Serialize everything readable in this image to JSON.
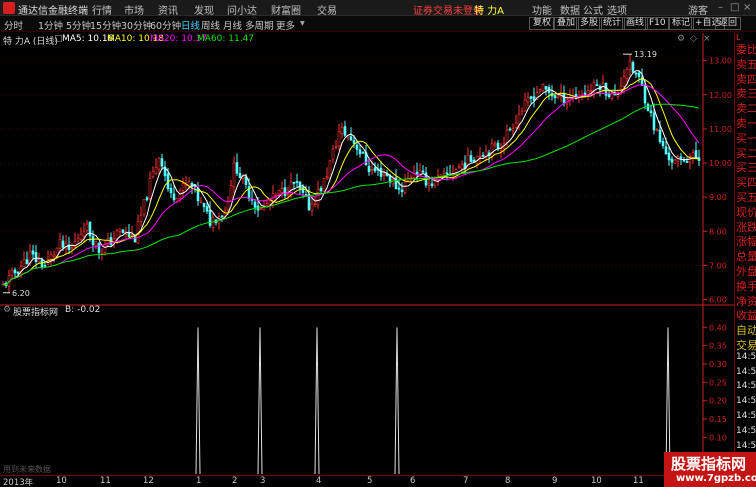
{
  "titlebar": {
    "app_name": "通达信金融终端",
    "menus": [
      "行情",
      "市场",
      "资讯",
      "发现",
      "问小达",
      "财富圈",
      "交易"
    ],
    "notice": "证券交易未登录",
    "stock": "特 力A",
    "right_menus": [
      "功能",
      "数据",
      "公式",
      "选项"
    ],
    "user": "游客"
  },
  "toolbar": {
    "periods": [
      "分时",
      "1分钟",
      "5分钟",
      "15分钟",
      "30分钟",
      "60分钟",
      "日线",
      "周线",
      "月线",
      "多周期",
      "更多"
    ],
    "active_period": "日线",
    "buttons": [
      "复权",
      "叠加",
      "多股",
      "统计",
      "画线",
      "F10",
      "标记",
      "+自选",
      "返回"
    ]
  },
  "legend": {
    "title": "特 力A (日线)",
    "ma5": "MA5: 10.16",
    "ma10": "MA10: 10.18",
    "ma20": "MA20: 10.37",
    "ma60": "MA60: 11.47"
  },
  "colors": {
    "up": "#ff3232",
    "down": "#54ffff",
    "ma5": "#ffffff",
    "ma10": "#ffff00",
    "ma20": "#ff00ff",
    "ma60": "#00e600",
    "axis": "#cc2020"
  },
  "annotations": {
    "high": "13.19",
    "low": "6.20"
  },
  "indicator": {
    "name": "股票指标网",
    "value": "B: -0.02"
  },
  "footnote": "用到未来数据",
  "months": [
    "2013年",
    "10",
    "11",
    "12",
    "1",
    "2",
    "3",
    "4",
    "5",
    "6",
    "7",
    "8",
    "9",
    "10",
    "11",
    "12"
  ],
  "sideboard": {
    "rows": [
      "委比",
      "卖五",
      "卖四",
      "卖三",
      "卖二",
      "卖一",
      "买一",
      "买二",
      "买三",
      "买四",
      "买五",
      "现价",
      "涨跌",
      "涨幅",
      "总量",
      "外盘",
      "换手",
      "净资",
      "收益",
      "自动",
      "交易",
      "14:56",
      "14:56",
      "14:56",
      "14:56",
      "14:56",
      "14:56",
      "14:56",
      "14:56"
    ],
    "corner": "L"
  },
  "watermark": {
    "title": "股票指标网",
    "url": "www.7gpzb.com"
  },
  "chart_data": [
    {
      "type": "candlestick",
      "title": "特 力A (日线)",
      "ylim": [
        5.9,
        13.4
      ],
      "y_ticks": [
        "13.00",
        "12.00",
        "11.00",
        "10.00",
        "9.00",
        "8.00",
        "7.00",
        "6.00"
      ],
      "x_ticks": [
        "2013年",
        "10",
        "11",
        "12",
        "1",
        "2",
        "3",
        "4",
        "5",
        "6",
        "7",
        "8",
        "9",
        "10",
        "11",
        "12"
      ],
      "series": [
        {
          "name": "MA5",
          "value": "10.16"
        },
        {
          "name": "MA10",
          "value": "10.18"
        },
        {
          "name": "MA20",
          "value": "10.37"
        },
        {
          "name": "MA60",
          "value": "11.47"
        }
      ],
      "anchors_x": [
        0,
        15,
        30,
        45,
        60,
        70,
        85,
        100,
        120,
        135,
        150,
        160,
        170,
        190,
        210,
        225,
        235,
        245,
        260,
        275,
        295,
        310,
        325,
        340,
        355,
        370,
        385,
        400,
        415,
        430,
        445,
        460,
        480,
        500,
        520,
        540,
        560,
        580,
        600,
        615,
        628,
        640,
        655,
        665,
        675,
        690,
        705
      ],
      "anchors_close": [
        6.3,
        6.8,
        7.3,
        7.0,
        7.6,
        7.4,
        8.2,
        7.4,
        8.0,
        7.8,
        9.4,
        10.3,
        9.0,
        9.4,
        8.3,
        8.6,
        10.0,
        9.3,
        8.6,
        9.0,
        9.4,
        8.7,
        9.5,
        11.0,
        10.6,
        9.8,
        9.7,
        9.2,
        9.8,
        9.4,
        9.6,
        9.9,
        10.3,
        10.5,
        11.5,
        12.2,
        11.9,
        12.0,
        12.3,
        11.9,
        12.9,
        12.4,
        11.0,
        10.3,
        10.0,
        10.2,
        10.1
      ],
      "annotations": [
        "13.19",
        "6.20"
      ]
    },
    {
      "type": "bar",
      "name": "股票指标网",
      "value_label": "B: -0.02",
      "ylim": [
        0,
        0.42
      ],
      "y_ticks": [
        "0.40",
        "0.35",
        "0.30",
        "0.25",
        "0.20",
        "0.15",
        "0.10",
        "0.05",
        "0.00"
      ],
      "signal_x_positions": [
        198,
        260,
        317,
        397,
        668
      ],
      "signal_value": 0.4
    }
  ]
}
